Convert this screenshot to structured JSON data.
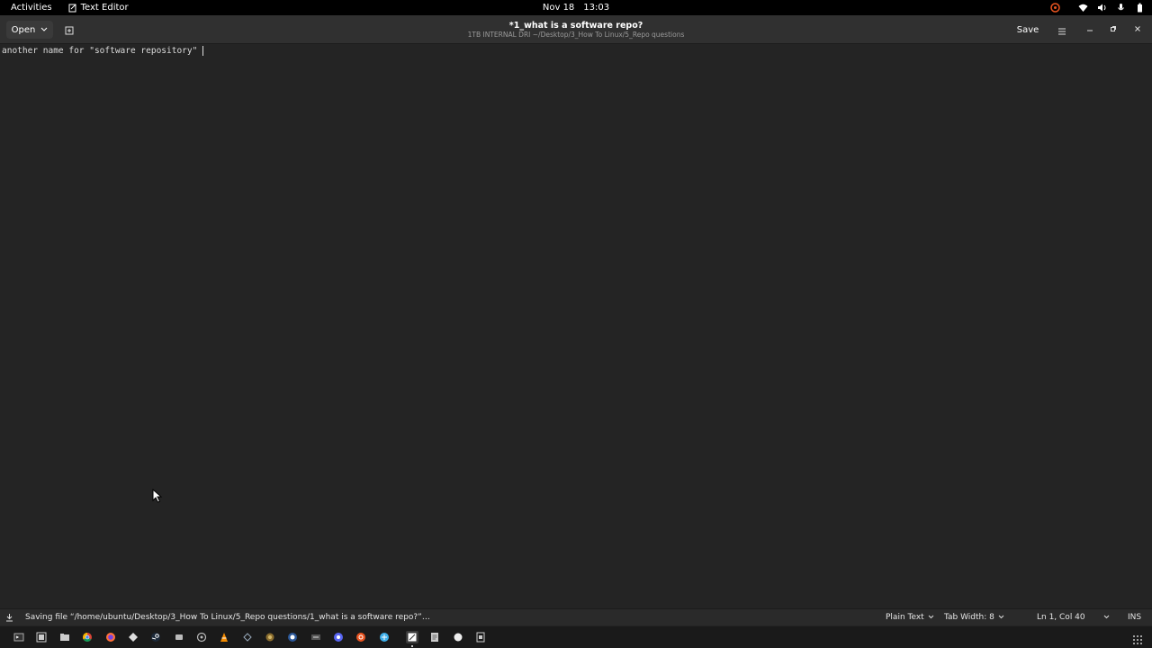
{
  "topbar": {
    "activities": "Activities",
    "app_name": "Text Editor",
    "date": "Nov 18",
    "time": "13:03"
  },
  "header": {
    "open_label": "Open",
    "title": "*1_what is a software repo?",
    "subtitle": "1TB INTERNAL DRI ~/Desktop/3_How To Linux/5_Repo questions",
    "save_label": "Save"
  },
  "editor": {
    "content": "another name for \"software repository\""
  },
  "statusbar": {
    "message": "Saving file “/home/ubuntu/Desktop/3_How To Linux/5_Repo questions/1_what is a software repo?”…",
    "language": "Plain Text",
    "tab_width": "Tab Width: 8",
    "position": "Ln 1, Col 40",
    "mode": "INS"
  },
  "dock": {
    "icons": [
      "terminal-icon",
      "screenshot-icon",
      "files-icon",
      "chrome-icon",
      "firefox-icon",
      "app-icon",
      "steam-icon",
      "app2-icon",
      "settings-icon",
      "vlc-icon",
      "app3-icon",
      "app4-icon",
      "app5-icon",
      "app6-icon",
      "app7-icon",
      "app8-icon",
      "app9-icon",
      "text-editor-icon",
      "document-icon",
      "app10-icon",
      "app11-icon"
    ]
  },
  "colors": {
    "topbar_bg": "#000000",
    "header_bg": "#303030",
    "editor_bg": "#242424",
    "accent": "#e95420"
  }
}
